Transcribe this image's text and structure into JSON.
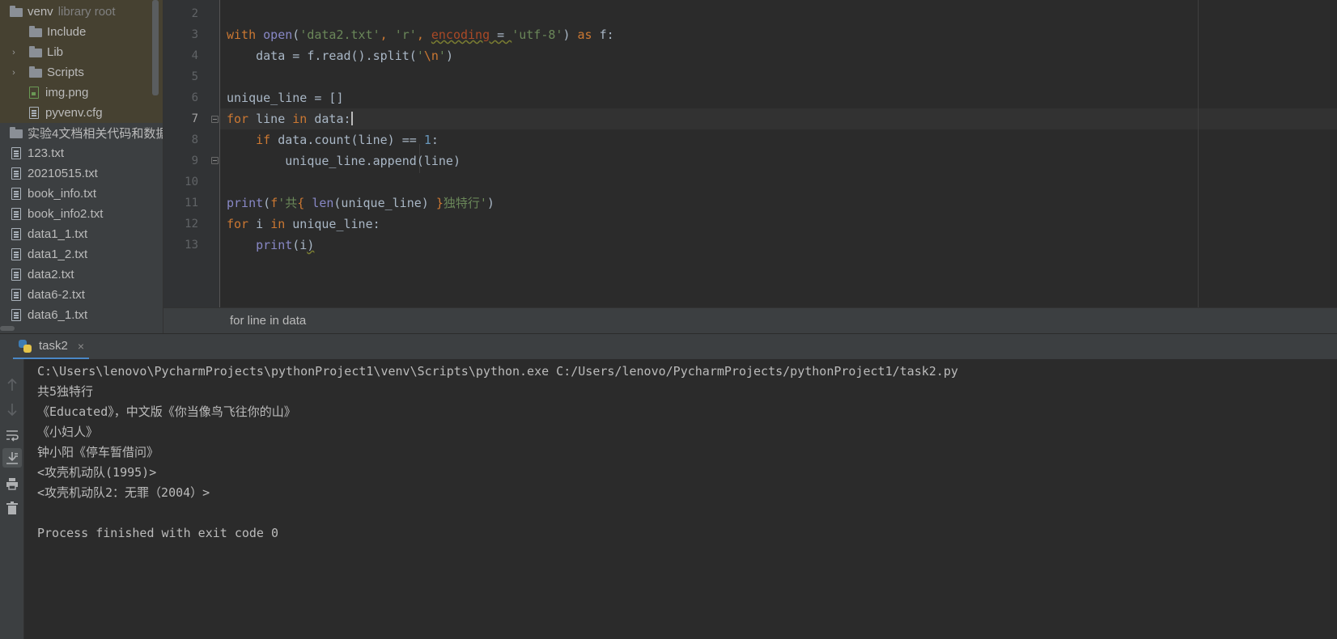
{
  "project_tree": {
    "items": [
      {
        "label": "venv",
        "suffix": "library root",
        "type": "folder",
        "chevron": ""
      },
      {
        "label": "Include",
        "type": "folder",
        "chevron": ""
      },
      {
        "label": "Lib",
        "type": "folder",
        "chevron": "›"
      },
      {
        "label": "Scripts",
        "type": "folder",
        "chevron": "›"
      },
      {
        "label": "img.png",
        "type": "image",
        "chevron": ""
      },
      {
        "label": "pyvenv.cfg",
        "type": "file",
        "chevron": ""
      },
      {
        "label": "实验4文档相关代码和数据",
        "type": "folder",
        "chevron": ""
      },
      {
        "label": "123.txt",
        "type": "file",
        "chevron": ""
      },
      {
        "label": "20210515.txt",
        "type": "file",
        "chevron": ""
      },
      {
        "label": "book_info.txt",
        "type": "file",
        "chevron": ""
      },
      {
        "label": "book_info2.txt",
        "type": "file",
        "chevron": ""
      },
      {
        "label": "data1_1.txt",
        "type": "file",
        "chevron": ""
      },
      {
        "label": "data1_2.txt",
        "type": "file",
        "chevron": ""
      },
      {
        "label": "data2.txt",
        "type": "file",
        "chevron": ""
      },
      {
        "label": "data6-2.txt",
        "type": "file",
        "chevron": ""
      },
      {
        "label": "data6_1.txt",
        "type": "file",
        "chevron": ""
      }
    ]
  },
  "editor": {
    "line_numbers": [
      "2",
      "3",
      "4",
      "5",
      "6",
      "7",
      "8",
      "9",
      "10",
      "11",
      "12",
      "13"
    ],
    "current_line": "7",
    "code": {
      "l3": {
        "with": "with",
        "open": "open",
        "p1": "(",
        "s1": "'data2.txt'",
        "c1": ", ",
        "s2": "'r'",
        "c2": ", ",
        "enc": "encoding",
        "eq": " = ",
        "s3": "'utf-8'",
        "p2": ") ",
        "as": "as",
        "f": " f:"
      },
      "l4": {
        "a": "    data = f.read().split(",
        "q1": "'",
        "esc": "\\n",
        "q2": "'",
        "b": ")"
      },
      "l6": {
        "a": "unique_line = []"
      },
      "l7": {
        "for": "for",
        "a": " line ",
        "in": "in",
        "b": " data:"
      },
      "l8": {
        "ind": "    ",
        "if": "if",
        "a": " data.count(line) == ",
        "one": "1",
        "b": ":"
      },
      "l9": {
        "a": "        unique_line.append(line)"
      },
      "l11": {
        "print": "print",
        "p": "(",
        "f": "f",
        "s1": "'共",
        "br1": "{ ",
        "len": "len",
        "a": "(unique_line) ",
        "br2": "}",
        "s2": "独特行'",
        "close": ")"
      },
      "l12": {
        "for": "for",
        "a": " i ",
        "in": "in",
        "b": " unique_line:"
      },
      "l13": {
        "ind": "    ",
        "print": "print",
        "a": "(i",
        "b": ")"
      }
    }
  },
  "breadcrumb": {
    "text": "for line in data"
  },
  "run": {
    "tab_label": "task2",
    "tab_close": "×",
    "console": [
      "C:\\Users\\lenovo\\PycharmProjects\\pythonProject1\\venv\\Scripts\\python.exe C:/Users/lenovo/PycharmProjects/pythonProject1/task2.py",
      "共5独特行",
      "《Educated》，中文版《你当像鸟飞往你的山》",
      "《小妇人》",
      "钟小阳《停车暂借问》",
      "<攻壳机动队(1995)>",
      "<攻壳机动队2：无罪（2004）>",
      "",
      "Process finished with exit code 0"
    ]
  },
  "toolbar_icons": [
    "up-arrow-icon",
    "down-arrow-icon",
    "soft-wrap-icon",
    "scroll-to-end-icon",
    "print-icon",
    "trash-icon"
  ]
}
